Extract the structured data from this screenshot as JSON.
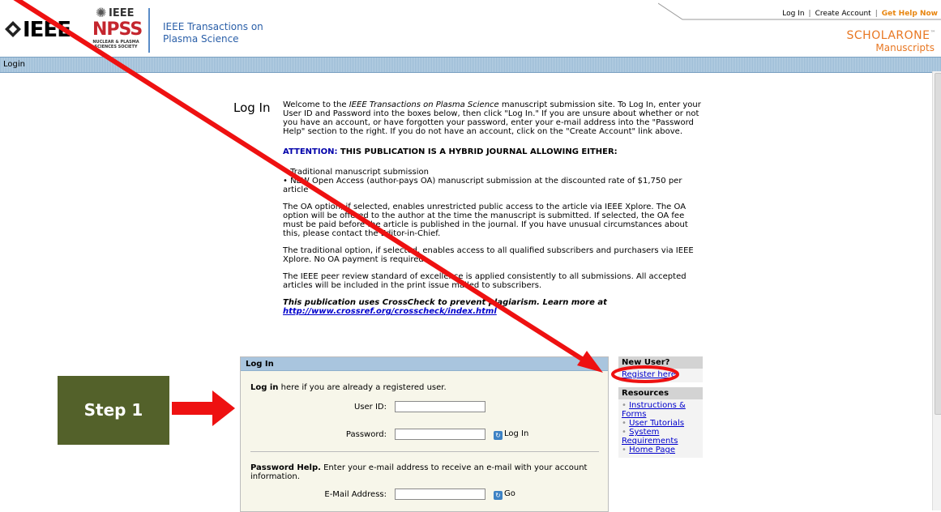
{
  "header": {
    "ieee_word": "IEEE",
    "npss_ieee": "IEEE",
    "npss_name": "NPSS",
    "npss_society": "NUCLEAR & PLASMA SCIENCES SOCIETY",
    "journal_line1": "IEEE Transactions on",
    "journal_line2": "Plasma Science",
    "top_links": {
      "login": "Log In",
      "create": "Create Account",
      "help": "Get Help Now"
    },
    "brand": "SCHOLARONE",
    "brand_tm": "™",
    "brand_sub": "Manuscripts"
  },
  "nav": {
    "label": "Login"
  },
  "intro": {
    "heading": "Log In",
    "welcome_pre": "Welcome to the ",
    "welcome_journal": "IEEE Transactions on Plasma Science",
    "welcome_post": " manuscript submission site. To Log In, enter your User ID and Password into the boxes below, then click \"Log In.\" If you are unsure about whether or not you have an account, or have forgotten your password, enter your e-mail address into the \"Password Help\" section to the right. If you do not have an account, click on the \"Create Account\" link above.",
    "attention_label": "ATTENTION:",
    "attention_text": " THIS PUBLICATION IS A HYBRID JOURNAL ALLOWING EITHER:",
    "option1": "• Traditional manuscript submission",
    "option2": "• NEW Open Access (author-pays OA) manuscript submission at the discounted rate of $1,750 per article",
    "oa_text": "The OA option, if selected, enables unrestricted public access to the article via IEEE Xplore. The OA option will be offered to the author at the time the manuscript is submitted. If selected, the OA fee must be paid before the article is published in the journal. If you have unusual circumstances about this, please contact the Editor-in-Chief.",
    "trad_text": "The traditional option, if selected, enables access to all qualified subscribers and purchasers via IEEE Xplore. No OA payment is required.",
    "review_text": "The IEEE peer review standard of excellence is applied consistently to all submissions. All accepted articles will be included in the print issue mailed to subscribers.",
    "crosscheck_text": "This publication uses CrossCheck to prevent plagiarism. Learn more at",
    "crosscheck_link": "http://www.crossref.org/crosscheck/index.html"
  },
  "login_panel": {
    "title": "Log In",
    "intro_bold": "Log in",
    "intro_rest": " here if you are already a registered user.",
    "userid_label": "User ID:",
    "userid_value": "",
    "password_label": "Password:",
    "password_value": "",
    "login_button": "Log In",
    "pw_help_bold": "Password Help.",
    "pw_help_rest": " Enter your e-mail address to receive an e-mail with your account information.",
    "email_label": "E-Mail Address:",
    "email_value": "",
    "go_button": "Go"
  },
  "sidebar": {
    "new_user_title": "New User?",
    "register_link": "Register here",
    "resources_title": "Resources",
    "resources": [
      "Instructions & Forms",
      "User Tutorials",
      "System Requirements",
      "Home Page"
    ]
  },
  "annotation": {
    "step_label": "Step 1",
    "arrow_color": "#ee1111",
    "step_color": "#53612a"
  }
}
